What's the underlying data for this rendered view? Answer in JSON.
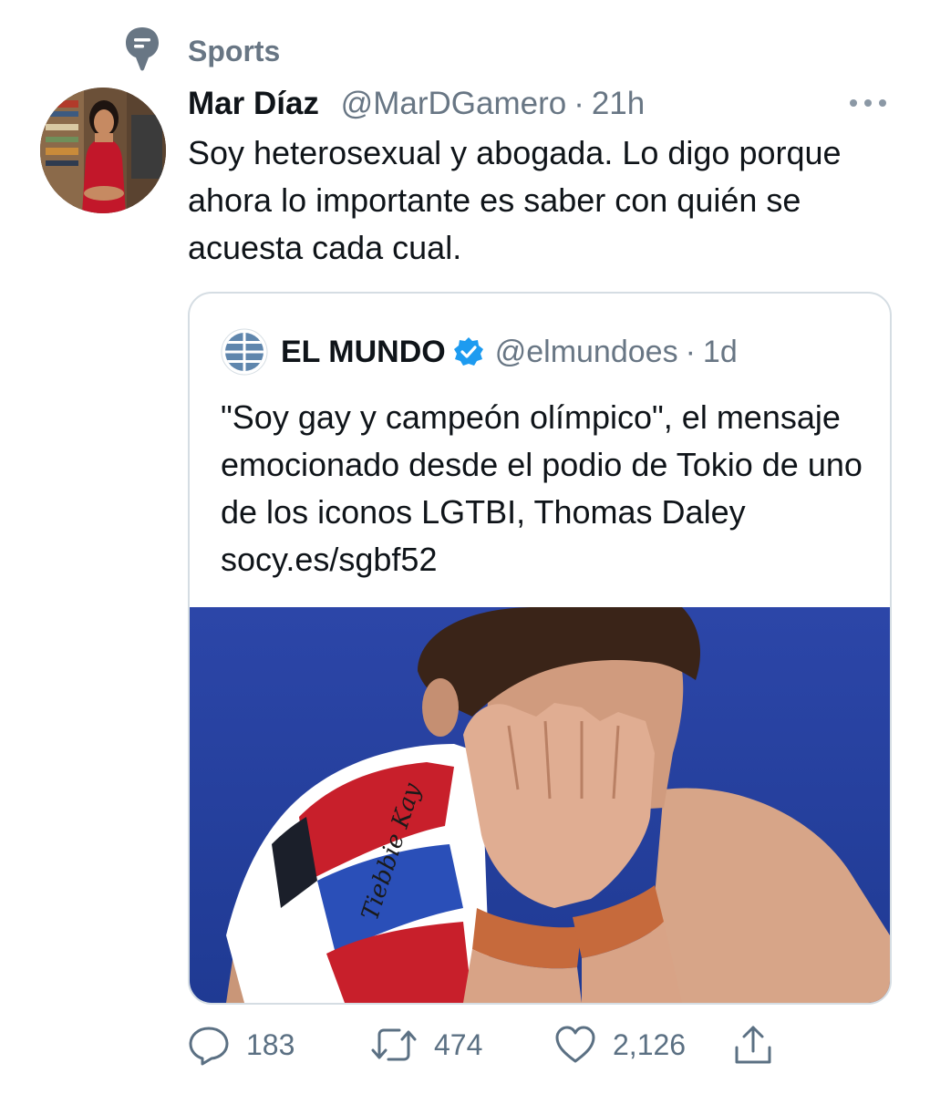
{
  "context": {
    "topic_icon": "topic-bubble-icon",
    "label": "Sports"
  },
  "tweet": {
    "author_name": "Mar Díaz",
    "author_handle": "@MarDGamero",
    "separator": "·",
    "time": "21h",
    "more_icon": "more-dots-icon",
    "text": "Soy heterosexual y abogada. Lo digo porque ahora lo importante es saber con quién se acuesta cada cual."
  },
  "quote": {
    "avatar_icon": "el-mundo-logo",
    "name": "EL MUNDO",
    "verified_icon": "verified-badge-icon",
    "handle": "@elmundoes",
    "separator": "·",
    "time": "1d",
    "text": "\"Soy gay y campeón olímpico\", el mensaje emocionado desde el podio de Tokio de uno de los iconos LGTBI, Thomas Daley socy.es/sgbf52",
    "image_text": "Tiebbie Kay"
  },
  "actions": {
    "reply": {
      "icon": "reply-icon",
      "count": "183"
    },
    "retweet": {
      "icon": "retweet-icon",
      "count": "474"
    },
    "like": {
      "icon": "heart-icon",
      "count": "2,126"
    },
    "share": {
      "icon": "share-icon"
    }
  },
  "colors": {
    "secondary_text": "#687684",
    "verified_blue": "#1d9bf0",
    "border": "#d5dde3"
  }
}
